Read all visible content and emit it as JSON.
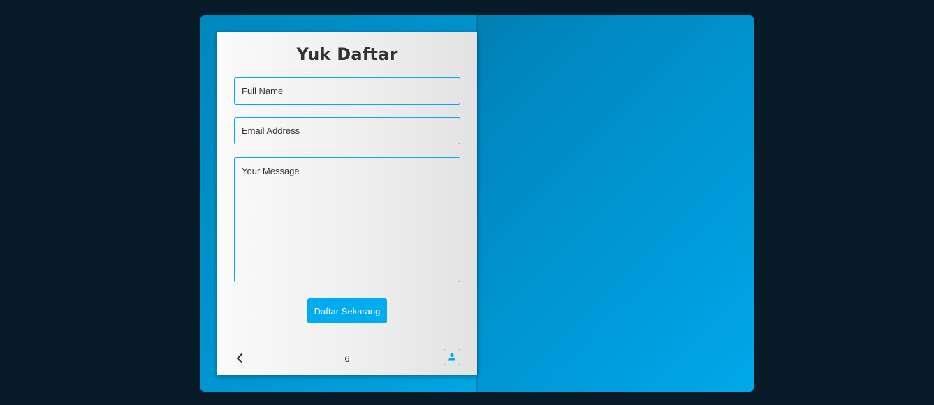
{
  "form": {
    "title": "Yuk Daftar",
    "name_placeholder": "Full Name",
    "email_placeholder": "Email Address",
    "message_placeholder": "Your Message",
    "submit_label": "Daftar Sekarang"
  },
  "footer": {
    "page_number": "6",
    "prev_icon": "chevron-left-icon",
    "profile_icon": "user-icon"
  },
  "colors": {
    "accent": "#00abf0",
    "background": "#081b29",
    "text": "#333333"
  }
}
